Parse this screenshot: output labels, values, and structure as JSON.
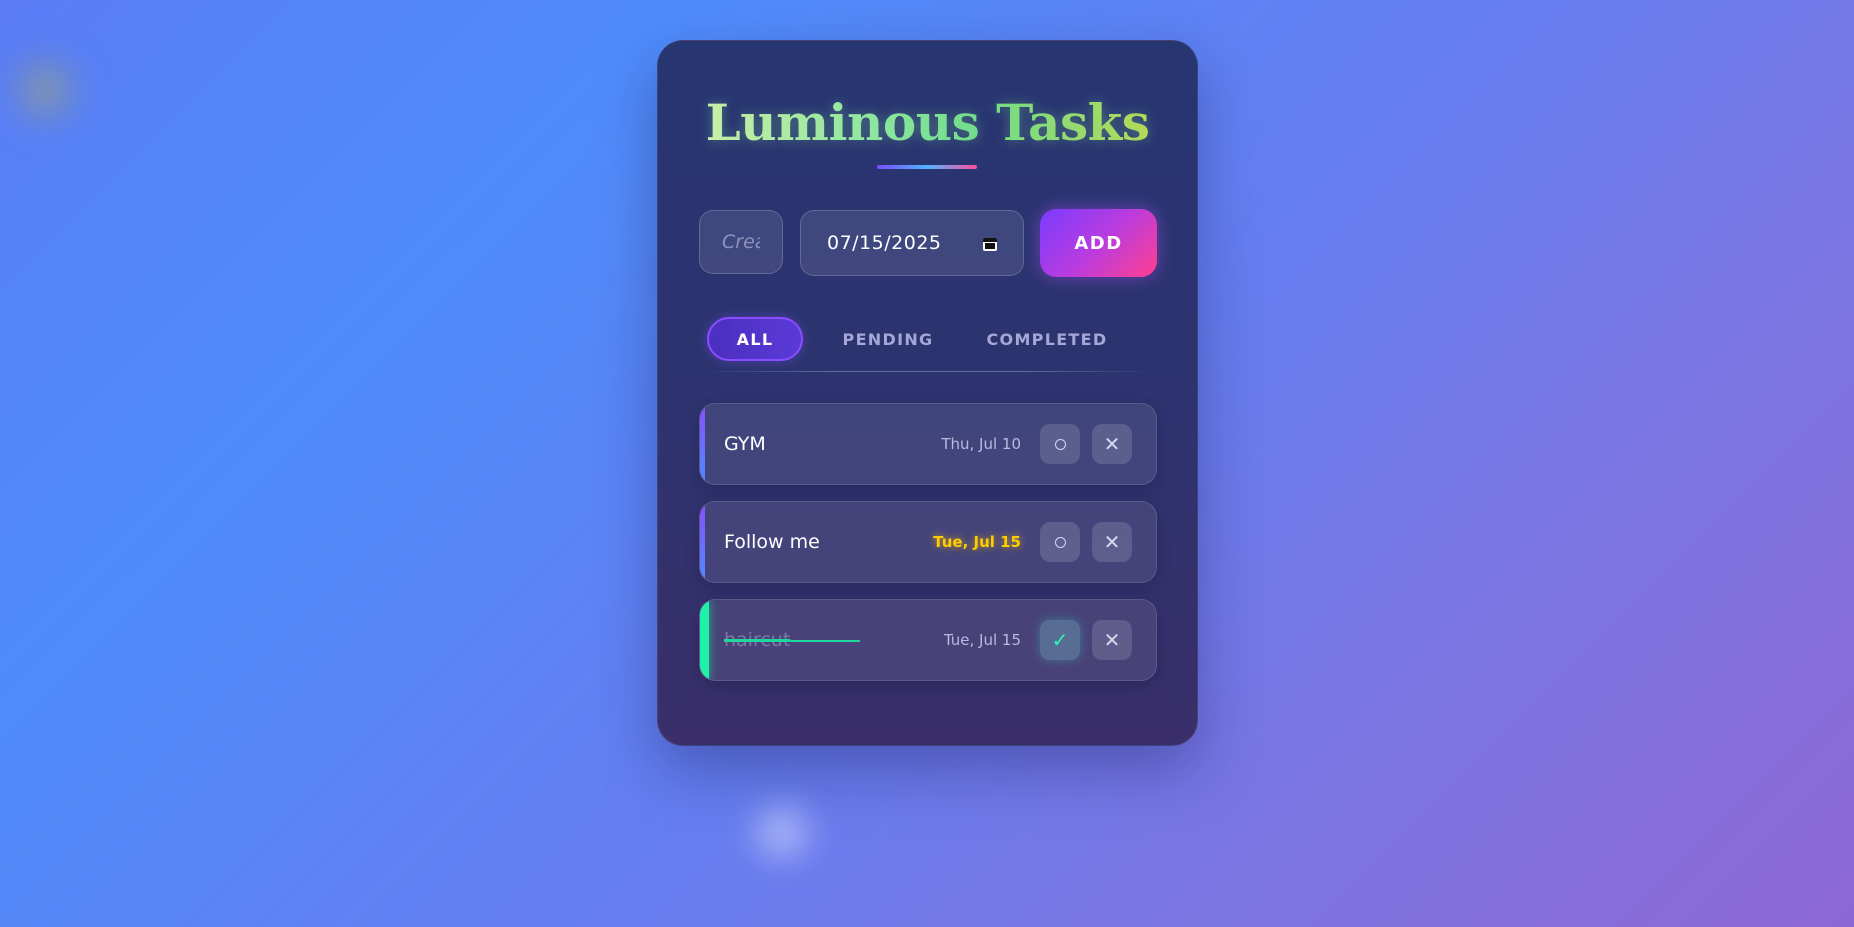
{
  "app": {
    "title": "Luminous Tasks"
  },
  "form": {
    "task_placeholder": "Create a new task",
    "task_value": "",
    "date_value": "07/15/2025",
    "add_label": "ADD"
  },
  "filters": [
    {
      "label": "ALL",
      "active": true
    },
    {
      "label": "PENDING",
      "active": false
    },
    {
      "label": "COMPLETED",
      "active": false
    }
  ],
  "tasks": [
    {
      "name": "GYM",
      "date": "Thu, Jul 10",
      "completed": false,
      "today": false
    },
    {
      "name": "Follow me",
      "date": "Tue, Jul 15",
      "completed": false,
      "today": true
    },
    {
      "name": "haircut",
      "date": "Tue, Jul 15",
      "completed": true,
      "today": false
    }
  ],
  "icons": {
    "toggle_pending": "circle-icon",
    "toggle_done": "check-icon",
    "delete": "close-icon",
    "date_picker": "calendar-icon"
  },
  "colors": {
    "accent_purple": "#7a3cff",
    "accent_pink": "#ff3f8f",
    "completed_green": "#1ef2a8",
    "today_yellow": "#ffcc00"
  }
}
